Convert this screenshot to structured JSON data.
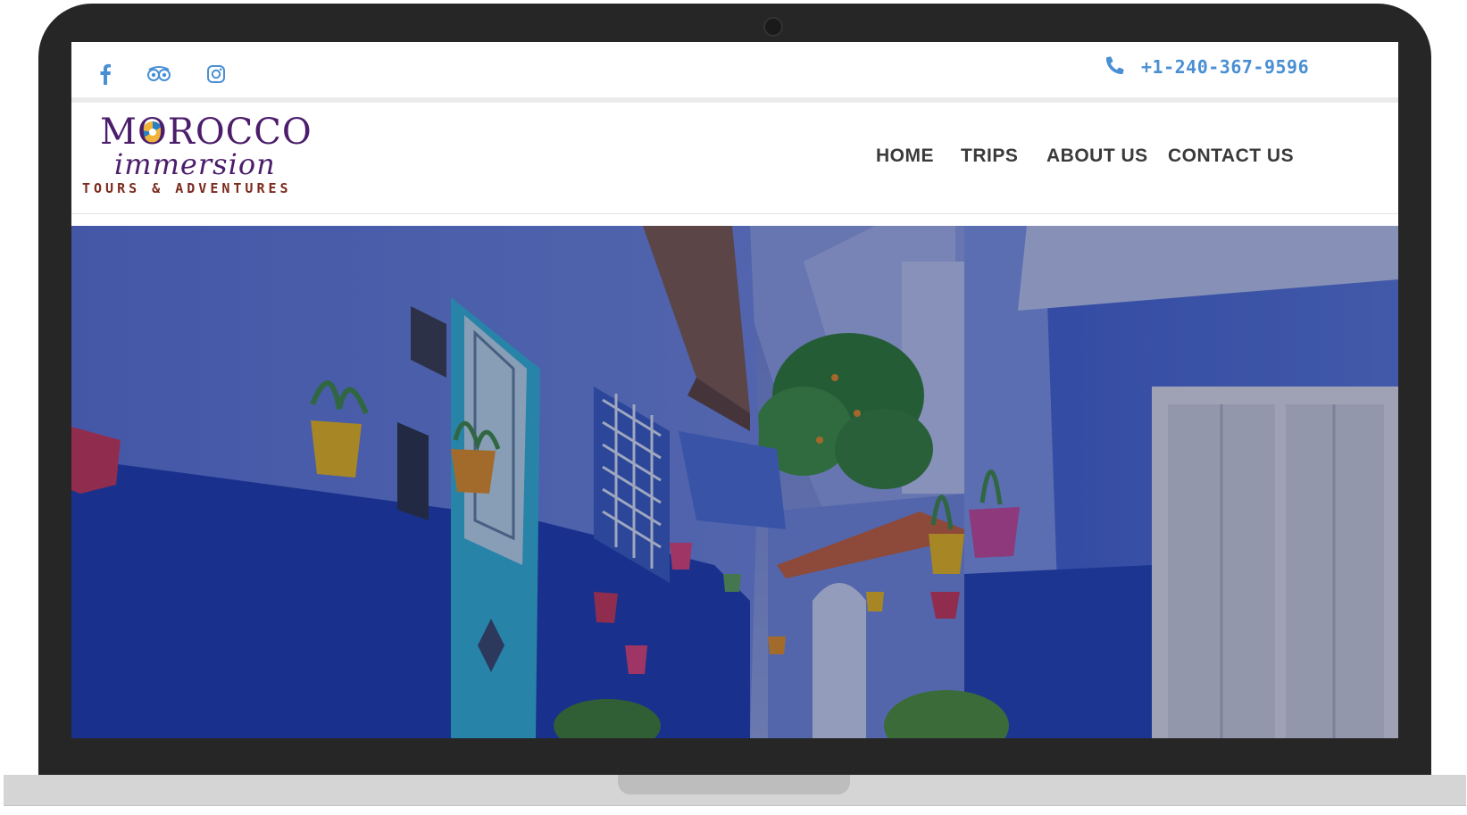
{
  "topbar": {
    "social": [
      {
        "name": "facebook",
        "icon": "facebook-icon"
      },
      {
        "name": "tripadvisor",
        "icon": "tripadvisor-icon"
      },
      {
        "name": "instagram",
        "icon": "instagram-icon"
      }
    ],
    "phone_icon": "phone-icon",
    "phone_number": "+1-240-367-9596",
    "accent_color": "#4a8fd4"
  },
  "header": {
    "logo": {
      "line1": "MOROCCO",
      "line2": "immersion",
      "line3": "TOURS & ADVENTURES",
      "primary_color": "#4b1d6b",
      "tag_color": "#7a2a1c"
    },
    "nav": [
      {
        "label": "HOME"
      },
      {
        "label": "TRIPS"
      },
      {
        "label": "ABOUT US"
      },
      {
        "label": "CONTACT US"
      }
    ]
  },
  "hero": {
    "image": "blue-alley-photo",
    "colors": {
      "wall_dark": "#1e3fb0",
      "wall_light": "#4f6fd8",
      "door": "#37b4d8"
    }
  }
}
